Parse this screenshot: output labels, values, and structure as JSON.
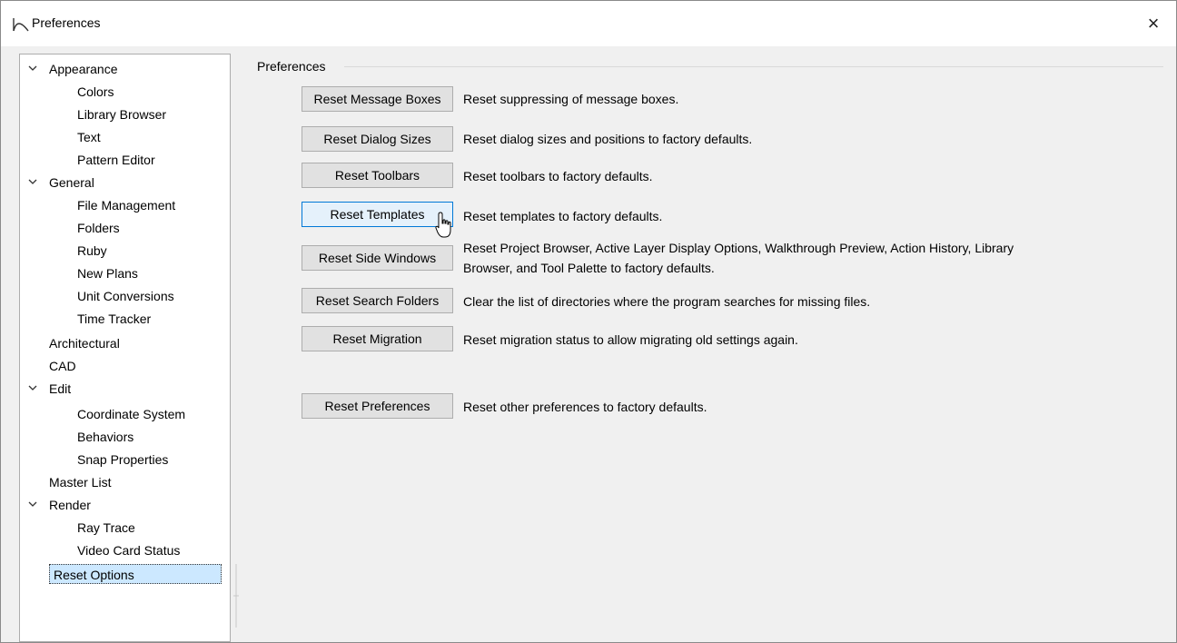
{
  "window": {
    "title": "Preferences",
    "close_glyph": "×",
    "icon": "app-arc-icon"
  },
  "tree": {
    "items": [
      {
        "label": "Appearance",
        "level": 0,
        "expanded": true
      },
      {
        "label": "Colors",
        "level": 1
      },
      {
        "label": "Library Browser",
        "level": 1
      },
      {
        "label": "Text",
        "level": 1
      },
      {
        "label": "Pattern Editor",
        "level": 1
      },
      {
        "label": "General",
        "level": 0,
        "expanded": true
      },
      {
        "label": "File Management",
        "level": 1
      },
      {
        "label": "Folders",
        "level": 1
      },
      {
        "label": "Ruby",
        "level": 1
      },
      {
        "label": "New Plans",
        "level": 1
      },
      {
        "label": "Unit Conversions",
        "level": 1
      },
      {
        "label": "Time Tracker",
        "level": 1
      },
      {
        "label": "Architectural",
        "level": 0
      },
      {
        "label": "CAD",
        "level": 0
      },
      {
        "label": "Edit",
        "level": 0,
        "expanded": true
      },
      {
        "label": "Coordinate System",
        "level": 1
      },
      {
        "label": "Behaviors",
        "level": 1
      },
      {
        "label": "Snap Properties",
        "level": 1
      },
      {
        "label": "Master List",
        "level": 0
      },
      {
        "label": "Render",
        "level": 0,
        "expanded": true
      },
      {
        "label": "Ray Trace",
        "level": 1
      },
      {
        "label": "Video Card Status",
        "level": 1
      },
      {
        "label": "Reset Options",
        "level": 0,
        "selected": true
      }
    ]
  },
  "panel": {
    "group_label": "Preferences",
    "rows": [
      {
        "button": "Reset Message Boxes",
        "description": "Reset suppressing of message boxes."
      },
      {
        "button": "Reset Dialog Sizes",
        "description": "Reset dialog sizes and positions to factory defaults."
      },
      {
        "button": "Reset Toolbars",
        "description": "Reset toolbars to factory defaults."
      },
      {
        "button": "Reset Templates",
        "description": "Reset templates to factory defaults.",
        "hovered": true
      },
      {
        "button": "Reset Side Windows",
        "description_line1": "Reset Project Browser, Active Layer Display Options, Walkthrough Preview, Action History, Library",
        "description_line2": "Browser, and Tool Palette to factory defaults."
      },
      {
        "button": "Reset Search Folders",
        "description": "Clear the list of directories where the program searches for missing files."
      },
      {
        "button": "Reset Migration",
        "description": "Reset migration status to allow migrating old settings again."
      },
      {
        "button": "Reset Preferences",
        "description": "Reset other preferences to factory defaults."
      }
    ]
  },
  "colors": {
    "window_bg": "#f0f0f0",
    "button_bg": "#e1e1e1",
    "button_hover_border": "#0078d7",
    "selection_bg": "#cce8ff"
  }
}
